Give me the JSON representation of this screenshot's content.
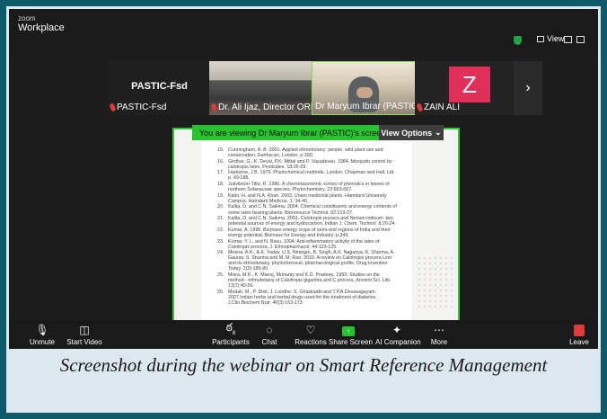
{
  "app": {
    "brand_small": "zoom",
    "brand_title": "Workplace",
    "view_label": "View"
  },
  "colors": {
    "accent_green": "#27c22d",
    "danger_red": "#e03a3a",
    "avatar_pink": "#e0305a"
  },
  "participants": [
    {
      "name": "PASTIC-Fsd",
      "top_label": "PASTIC-Fsd",
      "muted": true
    },
    {
      "name": "Dr. Ali Ijaz, Director ORIC...",
      "muted": true
    },
    {
      "name": "Dr Maryum Ibrar (PASTIC)",
      "muted": false,
      "active_speaker": true
    },
    {
      "name": "ZAIN ALI",
      "initial": "Z",
      "muted": true
    }
  ],
  "share": {
    "banner": "You are viewing  Dr Maryum Ibrar (PASTIC)'s screen",
    "view_options": "View Options"
  },
  "references": [
    {
      "n": "15.",
      "t": "Cunningham, A. B. 2001. Applied ethnobotany: people, wild plant use and conservation. Earthscan. London. p.300."
    },
    {
      "n": "16.",
      "t": "Girdhar, G., K. Deval, P.K. Mittal and P. Vasudevan. 1984. Mosquito control by calotropis latex. Pesticides. 18:26-29."
    },
    {
      "n": "17.",
      "t": "Harborne, J.B. 1976. Phytochemical methods. London. Chapman and Hall, Ltd. p. 49-188."
    },
    {
      "n": "18.",
      "t": "Jutiviboon-Tittu, R. 1986. A chemotaxonomic survey of phenolics in leaves of northern Solanaceae species. Phytochemistry. 23:663-667."
    },
    {
      "n": "19.",
      "t": "Kabir, H. and N.A. Khan. 2003. Unani medicinal plants. Hamdard University Campus, Hamdard Medicus. 1: 34-40."
    },
    {
      "n": "20.",
      "t": "Kalita, D. and C.N. Saikma. 2004. Chemical constituents and energy contents of some latex bearing plants. Bioresource Technol. 92:219-27."
    },
    {
      "n": "21.",
      "t": "Kalita, D. and C.N. Saikma. 2001. Calotropis procera and Nerium indicum: two potential sources of energy and hydrocarbon. Indian J. Chem. Technol. 8:20-24."
    },
    {
      "n": "22.",
      "t": "Kumar, A. 1996. Biomass energy crops of semi-arid regions of India and their energy potential. Biomass for Energy and Industry. p.349."
    },
    {
      "n": "23.",
      "t": "Kumar, Y. L. and N. Basu. 1994. Anti-inflammatory activity of the latex of Calotropis procera. J. Ethnopharmacol. 44:123-125."
    },
    {
      "n": "24.",
      "t": "Meena, A.K., A.K. Yadav, U.S. Niranjan, B. Singh, A.K. Nagariya, K. Sharma, A. Gaurav, S. Sharma and M. M. Rao. 2010. A review on Calotropis procera Linn and its ethnobotany, phytochemical, pharmacological profile. Drug Invention Today. 2(2):185-90."
    },
    {
      "n": "25.",
      "t": "Misra, M.K., K. Manoj, Mohanty and K.D. Pradeep. 1993. Studies on the method - ethnobotany of Calotropis gigantea and C.procera. Ancient Sci. Life. 13(1):40-56."
    },
    {
      "n": "26.",
      "t": "Modak, M., P. Dixit, J. Londhe, S. Ghaskadbi and T.P.A.Devasagayam. 2007.Indian herbs and herbal drugs used for the treatment of diabetes. J.Clin.Biochem.Nutr. 40(3):163-173."
    }
  ],
  "toolbar": {
    "unmute": "Unmute",
    "start_video": "Start Video",
    "participants": "Participants",
    "participants_count": "8",
    "chat": "Chat",
    "reactions": "Reactions",
    "share_screen": "Share Screen",
    "ai_companion": "AI Companion",
    "more": "More",
    "leave": "Leave"
  },
  "caption": "Screenshot during the webinar on Smart Reference Management"
}
